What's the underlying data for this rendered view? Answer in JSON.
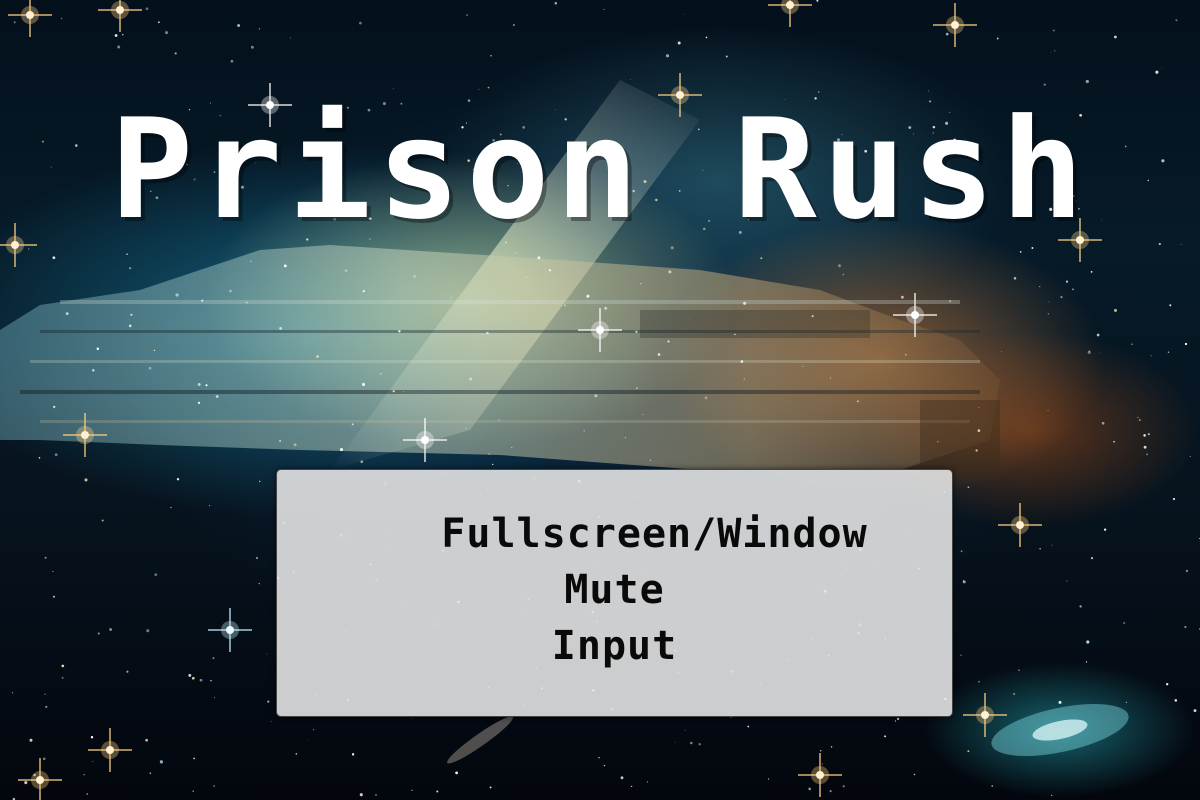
{
  "game": {
    "title": "Prison Rush"
  },
  "menu": {
    "items": [
      {
        "label": "Fullscreen/Window"
      },
      {
        "label": "Mute"
      },
      {
        "label": "Input"
      }
    ]
  },
  "colors": {
    "title_text": "#ffffff",
    "panel_background": "#e8e8e8",
    "menu_text": "#0a0a0a"
  }
}
